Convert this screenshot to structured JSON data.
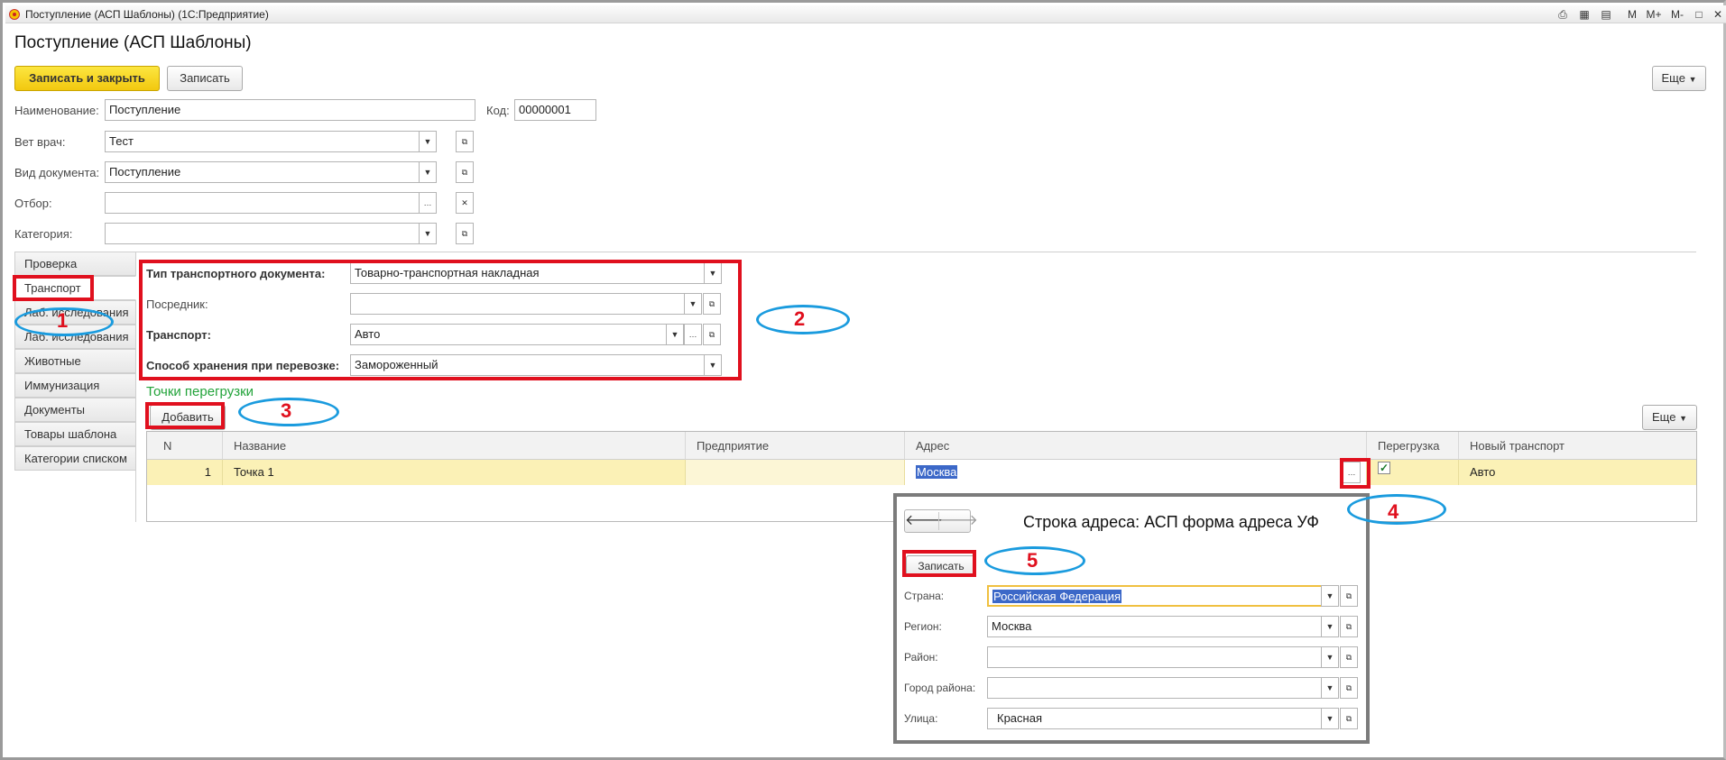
{
  "window": {
    "title": "Поступление (АСП Шаблоны)  (1С:Предприятие)",
    "controls": [
      "M",
      "M+",
      "M-",
      "□",
      "✕"
    ]
  },
  "form": {
    "title": "Поступление (АСП Шаблоны)",
    "save_close_label": "Записать и закрыть",
    "save_label": "Записать",
    "more_label": "Еще",
    "name_label": "Наименование:",
    "name_value": "Поступление",
    "code_label": "Код:",
    "code_value": "00000001",
    "vet_label": "Вет врач:",
    "vet_value": "Тест",
    "doctype_label": "Вид документа:",
    "doctype_value": "Поступление",
    "filter_label": "Отбор:",
    "filter_value": "",
    "category_label": "Категория:",
    "category_value": ""
  },
  "tabs": [
    {
      "label": "Проверка"
    },
    {
      "label": "Транспорт"
    },
    {
      "label": "Лаб. исследования"
    },
    {
      "label": "Лаб. исследования"
    },
    {
      "label": "Животные"
    },
    {
      "label": "Иммунизация"
    },
    {
      "label": "Документы"
    },
    {
      "label": "Товары шаблона"
    },
    {
      "label": "Категории списком"
    }
  ],
  "transport": {
    "doc_type_label": "Тип транспортного документа:",
    "doc_type_value": "Товарно-транспортная накладная",
    "agent_label": "Посредник:",
    "agent_value": "",
    "transport_label": "Транспорт:",
    "transport_value": "Авто",
    "storage_label": "Способ хранения при перевозке:",
    "storage_value": "Замороженный"
  },
  "points": {
    "section_title": "Точки перегрузки",
    "add_label": "Добавить",
    "more_label": "Еще",
    "columns": [
      "N",
      "Название",
      "Предприятие",
      "Адрес",
      "Перегрузка",
      "Новый транспорт"
    ],
    "rows": [
      {
        "n": "1",
        "name": "Точка 1",
        "company": "",
        "address": "Москва",
        "reload": true,
        "new_transport": "Авто"
      }
    ]
  },
  "popup": {
    "back": "🡐",
    "forward": "🡒",
    "title": "Строка адреса: АСП форма адреса УФ",
    "save_label": "Записать",
    "country_label": "Страна:",
    "country_value": "Российская Федерация",
    "region_label": "Регион:",
    "region_value": "Москва",
    "district_label": "Район:",
    "district_value": "",
    "city_label": "Город района:",
    "city_value": "",
    "street_label": "Улица:",
    "street_value": "Красная"
  },
  "annotations": [
    "1",
    "2",
    "3",
    "4",
    "5"
  ],
  "colors": {
    "accent": "#f2c80f",
    "annotation_red": "#e0101e",
    "annotation_blue": "#1a9bde",
    "section_green": "#22a33a",
    "selected_row": "#fbf1b6"
  }
}
